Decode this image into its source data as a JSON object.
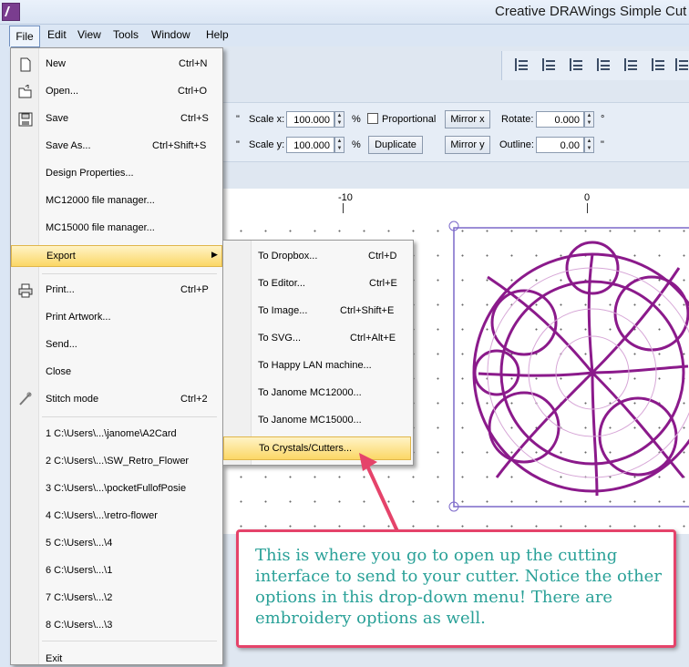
{
  "window": {
    "title": "Creative DRAWings Simple Cut -"
  },
  "menubar": {
    "items": [
      "File",
      "Edit",
      "View",
      "Tools",
      "Window",
      "Help"
    ]
  },
  "toolbar": {
    "unit_mark_1": "\"",
    "unit_mark_2": "\"",
    "scale_x_label": "Scale x:",
    "scale_x_value": "100.000",
    "scale_y_label": "Scale y:",
    "scale_y_value": "100.000",
    "percent_1": "%",
    "percent_2": "%",
    "proportional_label": "Proportional",
    "duplicate_label": "Duplicate",
    "mirror_x_label": "Mirror x",
    "mirror_y_label": "Mirror y",
    "rotate_label": "Rotate:",
    "rotate_value": "0.000",
    "degree_mark": "°",
    "outline_label": "Outline:",
    "outline_value": "0.00",
    "outline_unit": "\""
  },
  "ruler": {
    "labels": [
      "-10",
      "0"
    ]
  },
  "file_menu": {
    "items": [
      {
        "label": "New",
        "shortcut": "Ctrl+N",
        "icon": "new-document-icon"
      },
      {
        "label": "Open...",
        "shortcut": "Ctrl+O",
        "icon": "open-folder-icon"
      },
      {
        "label": "Save",
        "shortcut": "Ctrl+S",
        "icon": "save-disk-icon"
      },
      {
        "label": "Save As...",
        "shortcut": "Ctrl+Shift+S",
        "icon": ""
      },
      {
        "label": "Design Properties...",
        "shortcut": "",
        "icon": ""
      },
      {
        "label": "MC12000 file manager...",
        "shortcut": "",
        "icon": ""
      },
      {
        "label": "MC15000 file manager...",
        "shortcut": "",
        "icon": ""
      },
      {
        "label": "Export",
        "shortcut": "",
        "icon": ""
      },
      {
        "label": "Print...",
        "shortcut": "Ctrl+P",
        "icon": "printer-icon"
      },
      {
        "label": "Print Artwork...",
        "shortcut": "",
        "icon": ""
      },
      {
        "label": "Send...",
        "shortcut": "",
        "icon": ""
      },
      {
        "label": "Close",
        "shortcut": "",
        "icon": ""
      },
      {
        "label": "Stitch mode",
        "shortcut": "Ctrl+2",
        "icon": "needle-icon"
      }
    ],
    "recent": [
      "1 C:\\Users\\...\\janome\\A2Card",
      "2 C:\\Users\\...\\SW_Retro_Flower",
      "3 C:\\Users\\...\\pocketFullofPosie",
      "4 C:\\Users\\...\\retro-flower",
      "5 C:\\Users\\...\\4",
      "6 C:\\Users\\...\\1",
      "7 C:\\Users\\...\\2",
      "8 C:\\Users\\...\\3"
    ],
    "exit_label": "Exit"
  },
  "export_submenu": {
    "items": [
      {
        "label": "To Dropbox...",
        "shortcut": "Ctrl+D"
      },
      {
        "label": "To Editor...",
        "shortcut": "Ctrl+E"
      },
      {
        "label": "To Image...",
        "shortcut": "Ctrl+Shift+E"
      },
      {
        "label": "To SVG...",
        "shortcut": "Ctrl+Alt+E"
      },
      {
        "label": "To Happy LAN machine...",
        "shortcut": ""
      },
      {
        "label": "To Janome MC12000...",
        "shortcut": ""
      },
      {
        "label": "To Janome MC15000...",
        "shortcut": ""
      },
      {
        "label": "To Crystals/Cutters...",
        "shortcut": ""
      }
    ]
  },
  "callout": {
    "text": "This is where you go to open up the cutting interface to send to your cutter. Notice the other options in this drop-down menu! There are embroidery options as well."
  },
  "colors": {
    "accent_highlight": "#fbd766",
    "callout_border": "#e5436a",
    "callout_text": "#2aa198",
    "design_purple": "#8b1a8b"
  }
}
